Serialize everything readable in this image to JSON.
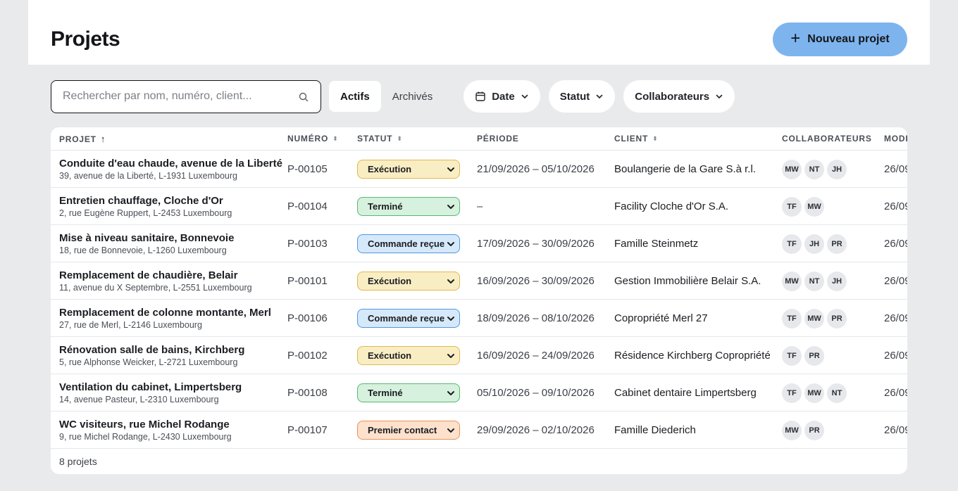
{
  "page": {
    "title": "Projets",
    "new_button_label": "Nouveau projet"
  },
  "search": {
    "placeholder": "Rechercher par nom, numéro, client..."
  },
  "tabs": [
    {
      "label": "Actifs",
      "active": true
    },
    {
      "label": "Archivés",
      "active": false
    }
  ],
  "filters": [
    {
      "label": "Date"
    },
    {
      "label": "Statut"
    },
    {
      "label": "Collaborateurs"
    }
  ],
  "table": {
    "columns": {
      "project": "PROJET",
      "number": "NUMÉRO",
      "status": "STATUT",
      "period": "PÉRIODE",
      "client": "CLIENT",
      "collaborators": "COLLABORATEURS",
      "modified": "MODI"
    },
    "rows": [
      {
        "name": "Conduite d'eau chaude, avenue de la Liberté",
        "address": "39, avenue de la Liberté, L-1931 Luxembourg",
        "number": "P-00105",
        "status": "Exécution",
        "period": "21/09/2026 – 05/10/2026",
        "client": "Boulangerie de la Gare S.à r.l.",
        "collaborators": [
          "MW",
          "NT",
          "JH"
        ],
        "modified": "26/09"
      },
      {
        "name": "Entretien chauffage, Cloche d'Or",
        "address": "2, rue Eugène Ruppert, L-2453 Luxembourg",
        "number": "P-00104",
        "status": "Terminé",
        "period": "–",
        "client": "Facility Cloche d'Or S.A.",
        "collaborators": [
          "TF",
          "MW"
        ],
        "modified": "26/09"
      },
      {
        "name": "Mise à niveau sanitaire, Bonnevoie",
        "address": "18, rue de Bonnevoie, L-1260 Luxembourg",
        "number": "P-00103",
        "status": "Commande reçue",
        "period": "17/09/2026 – 30/09/2026",
        "client": "Famille Steinmetz",
        "collaborators": [
          "TF",
          "JH",
          "PR"
        ],
        "modified": "26/09"
      },
      {
        "name": "Remplacement de chaudière, Belair",
        "address": "11, avenue du X Septembre, L-2551 Luxembourg",
        "number": "P-00101",
        "status": "Exécution",
        "period": "16/09/2026 – 30/09/2026",
        "client": "Gestion Immobilière Belair S.A.",
        "collaborators": [
          "MW",
          "NT",
          "JH"
        ],
        "modified": "26/09"
      },
      {
        "name": "Remplacement de colonne montante, Merl",
        "address": "27, rue de Merl, L-2146 Luxembourg",
        "number": "P-00106",
        "status": "Commande reçue",
        "period": "18/09/2026 – 08/10/2026",
        "client": "Copropriété Merl 27",
        "collaborators": [
          "TF",
          "MW",
          "PR"
        ],
        "modified": "26/09"
      },
      {
        "name": "Rénovation salle de bains, Kirchberg",
        "address": "5, rue Alphonse Weicker, L-2721 Luxembourg",
        "number": "P-00102",
        "status": "Exécution",
        "period": "16/09/2026 – 24/09/2026",
        "client": "Résidence Kirchberg Copropriété",
        "collaborators": [
          "TF",
          "PR"
        ],
        "modified": "26/09"
      },
      {
        "name": "Ventilation du cabinet, Limpertsberg",
        "address": "14, avenue Pasteur, L-2310 Luxembourg",
        "number": "P-00108",
        "status": "Terminé",
        "period": "05/10/2026 – 09/10/2026",
        "client": "Cabinet dentaire Limpertsberg",
        "collaborators": [
          "TF",
          "MW",
          "NT"
        ],
        "modified": "26/09"
      },
      {
        "name": "WC visiteurs, rue Michel Rodange",
        "address": "9, rue Michel Rodange, L-2430 Luxembourg",
        "number": "P-00107",
        "status": "Premier contact",
        "period": "29/09/2026 – 02/10/2026",
        "client": "Famille Diederich",
        "collaborators": [
          "MW",
          "PR"
        ],
        "modified": "26/09"
      }
    ],
    "footer": "8 projets"
  },
  "status_colors": {
    "Exécution": {
      "bg": "#f9edc3",
      "border": "#e0b94f"
    },
    "Terminé": {
      "bg": "#d6f1dd",
      "border": "#57b874"
    },
    "Commande reçue": {
      "bg": "#d6e9fb",
      "border": "#4f97e0"
    },
    "Premier contact": {
      "bg": "#fde1cc",
      "border": "#e89157"
    }
  },
  "colors": {
    "accent": "#7db4ee",
    "background": "#e8eaec"
  },
  "icons": {
    "new": "plus-icon",
    "search": "search-icon",
    "date": "calendar-icon",
    "dropdown": "chevron-down-icon",
    "sort_asc": "arrow-up-icon",
    "sortable": "sort-icon"
  }
}
